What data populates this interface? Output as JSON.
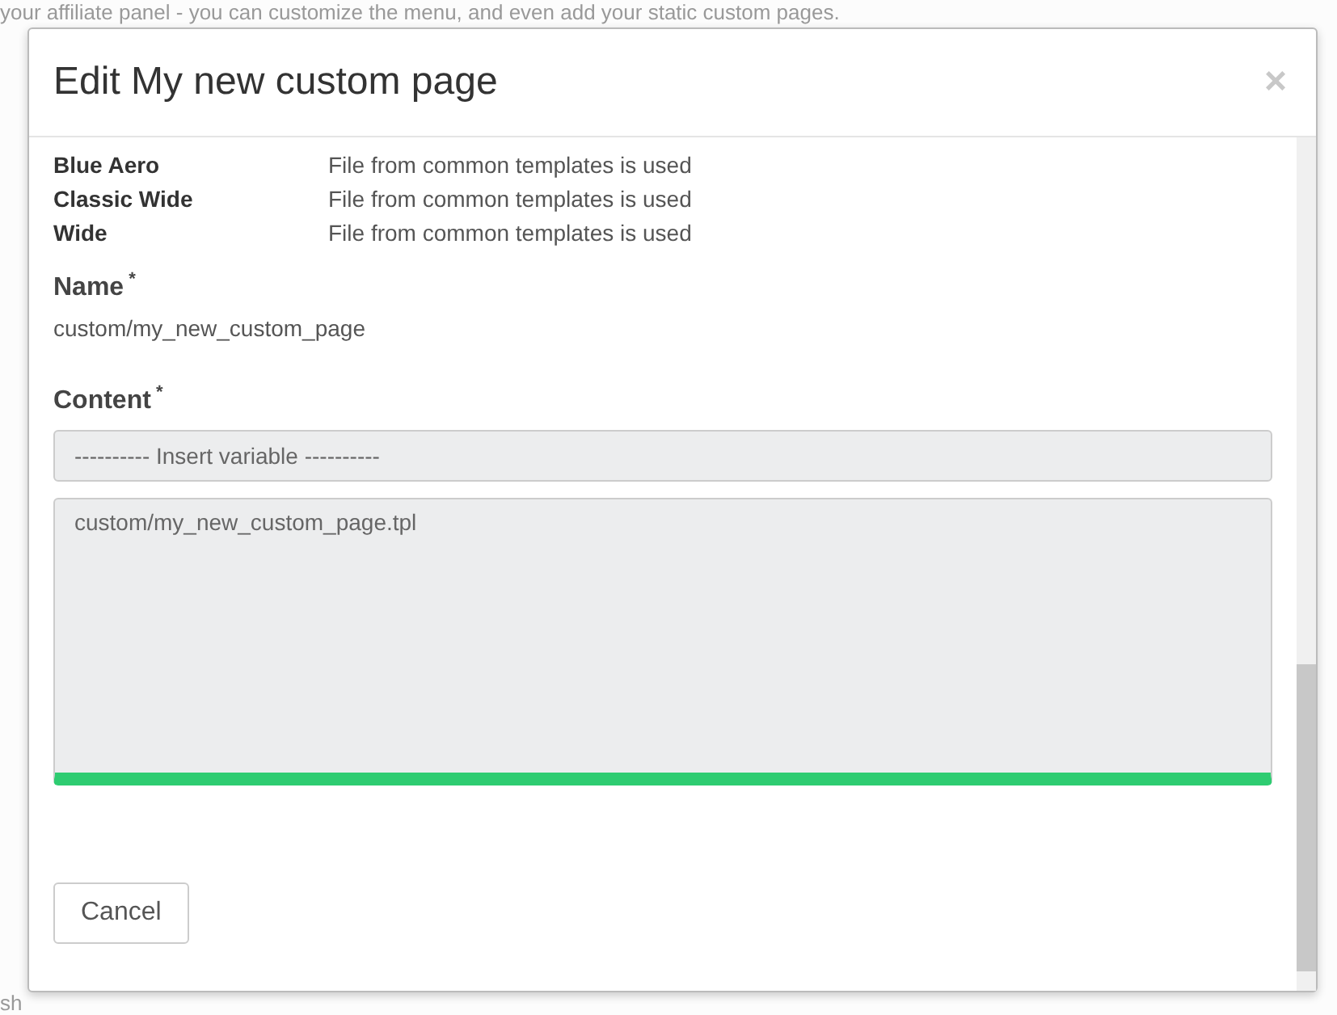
{
  "background": {
    "intro_text": "your affiliate panel - you can customize the menu, and even add your static custom pages.",
    "footer_fragment": "sh"
  },
  "modal": {
    "title": "Edit My new custom page",
    "close_label": "×",
    "templates": [
      {
        "name": "Blue Aero",
        "status": "File from common templates is used"
      },
      {
        "name": "Classic Wide",
        "status": "File from common templates is used"
      },
      {
        "name": "Wide",
        "status": "File from common templates is used"
      }
    ],
    "name_field": {
      "label": "Name",
      "required_mark": "*",
      "value": "custom/my_new_custom_page"
    },
    "content_field": {
      "label": "Content",
      "required_mark": "*",
      "variable_select": "---------- Insert variable ----------",
      "value": "custom/my_new_custom_page.tpl",
      "valid": true
    },
    "buttons": [
      {
        "label": "Cancel"
      }
    ]
  }
}
